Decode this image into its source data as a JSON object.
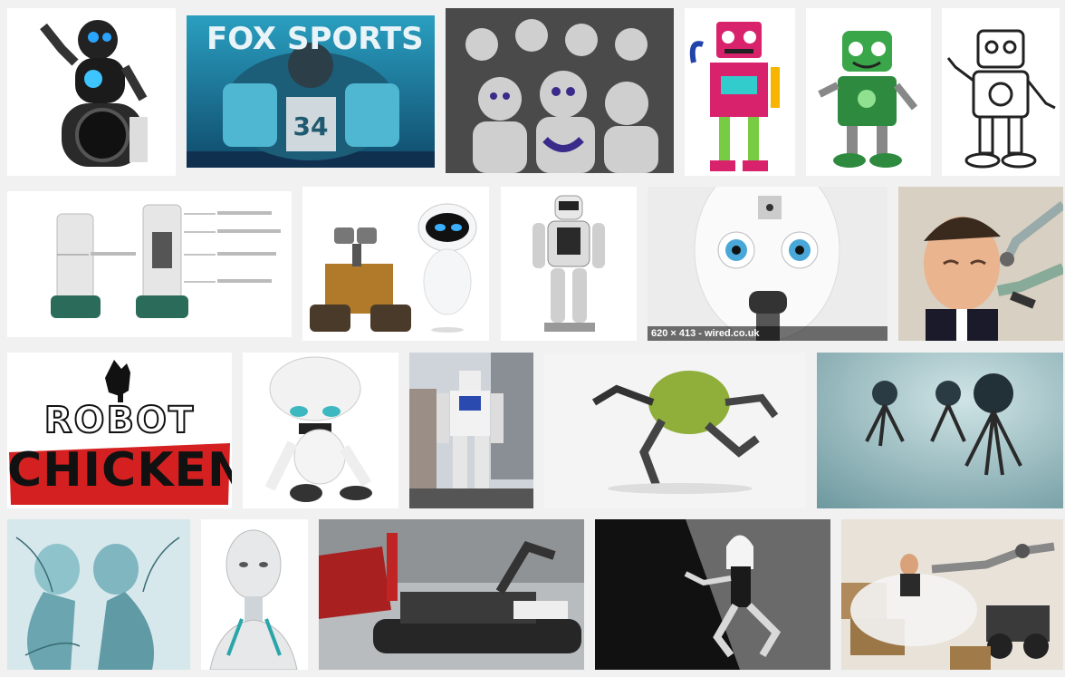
{
  "results": {
    "hover_caption": "620 × 413 - wired.co.uk",
    "tiles": [
      {
        "name": "mip-robot",
        "subject": "black and white self-balancing toy robot"
      },
      {
        "name": "fox-sports-robot",
        "logo_text": "FOX SPORTS",
        "jersey_number": "34"
      },
      {
        "name": "nao-robots-group",
        "subject": "group of small humanoid robots"
      },
      {
        "name": "red-cartoon-robot",
        "subject": "colorful cartoon robot"
      },
      {
        "name": "green-cartoon-robot",
        "subject": "green cartoon robot waving"
      },
      {
        "name": "line-art-robot",
        "subject": "black and white outline robot"
      },
      {
        "name": "service-robots-diagram",
        "subject": "two service kiosk robots with callouts"
      },
      {
        "name": "wall-e-and-eve",
        "subject": "WALL-E and EVE"
      },
      {
        "name": "humanoid-robot-white",
        "subject": "white humanoid walking robot"
      },
      {
        "name": "robot-face-closeup",
        "subject": "white robot face with blue eyes"
      },
      {
        "name": "man-with-robot-arms",
        "subject": "man with robotic makeup arms"
      },
      {
        "name": "robot-chicken-logo",
        "logo_line1": "ROBOT",
        "logo_line2": "CHICKEN"
      },
      {
        "name": "marvin-robot",
        "subject": "white sad cartoon robot sitting"
      },
      {
        "name": "gundam-statue",
        "subject": "giant mecha statue in city"
      },
      {
        "name": "green-pod-robot",
        "subject": "green pod with mechanical legs"
      },
      {
        "name": "spider-robots",
        "subject": "metal spider robots"
      },
      {
        "name": "cyborg-figures",
        "subject": "two cyan cyborg figures"
      },
      {
        "name": "android-head",
        "subject": "white android head and shoulders"
      },
      {
        "name": "bomb-disposal-robot",
        "subject": "tracked bomb disposal robot"
      },
      {
        "name": "woman-robot-pose",
        "subject": "woman in robot costume crouching"
      },
      {
        "name": "robot-arm-moving-boxes",
        "subject": "robot arm lifting man amid boxes"
      }
    ]
  },
  "colors": {
    "background": "#f1f1f1",
    "caption_bg": "rgba(0,0,0,0.55)",
    "robot_chicken_red": "#d42020",
    "fox_teal": "#1f6f8a"
  }
}
